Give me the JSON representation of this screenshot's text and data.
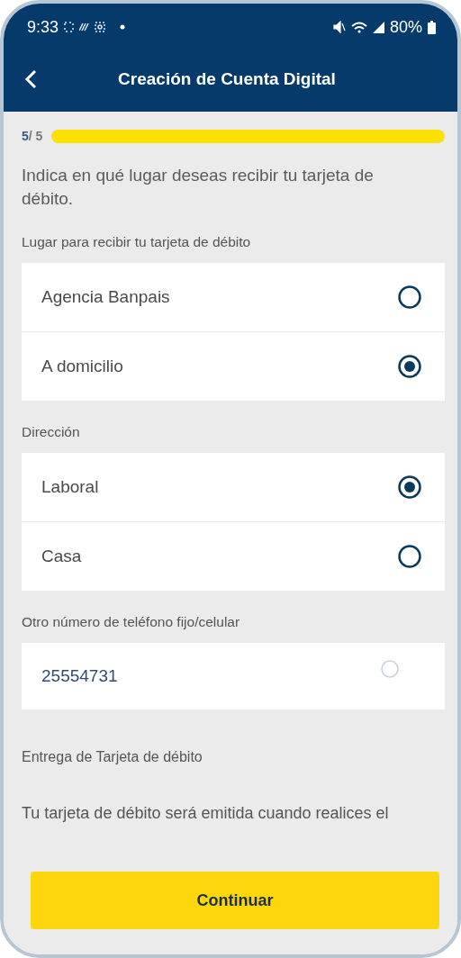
{
  "status_bar": {
    "time": "9:33",
    "battery": "80%"
  },
  "header": {
    "title": "Creación de Cuenta Digital"
  },
  "progress": {
    "current": "5",
    "total": "/ 5",
    "level": 1
  },
  "intro": "Indica en qué lugar deseas recibir tu tarjeta de débito.",
  "groups": [
    {
      "label": "Lugar para recibir tu tarjeta de débito",
      "options": [
        {
          "label": "Agencia Banpais",
          "selected": false
        },
        {
          "label": "A domicilio",
          "selected": true
        }
      ]
    },
    {
      "label": "Dirección",
      "options": [
        {
          "label": "Laboral",
          "selected": true
        },
        {
          "label": "Casa",
          "selected": false
        }
      ]
    }
  ],
  "phone_field": {
    "label": "Otro número de teléfono fijo/celular",
    "value": "25554731"
  },
  "delivery": {
    "title": "Entrega de Tarjeta de débito",
    "text": "Tu tarjeta de débito será emitida cuando realices el"
  },
  "button": "Continuar"
}
